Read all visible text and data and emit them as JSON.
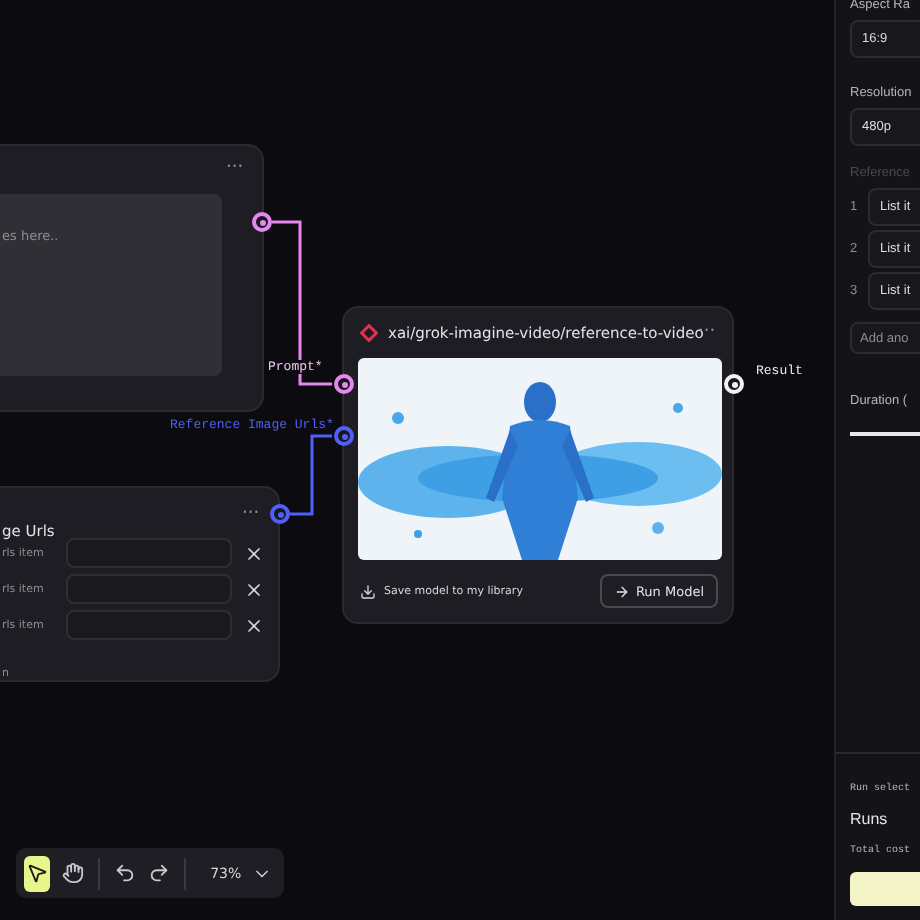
{
  "prompt_node": {
    "menu": "···",
    "placeholder": "es here.."
  },
  "reference_node": {
    "title": "ge Urls",
    "menu": "···",
    "items": [
      {
        "label": "rls item"
      },
      {
        "label": "rls item"
      },
      {
        "label": "rls item"
      }
    ],
    "add": "n"
  },
  "model_node": {
    "title": "xai/grok-imagine-video/reference-to-video",
    "menu": "···",
    "inputs": [
      {
        "label": "Prompt*",
        "color": "#e488ee"
      },
      {
        "label": "Reference Image Urls*",
        "color": "#4f5ff7"
      }
    ],
    "output": "Result",
    "save": "Save model to my library",
    "run": "Run Model"
  },
  "panel": {
    "aspect_label": "Aspect Ra",
    "aspect_value": "16:9",
    "resolution_label": "Resolution",
    "resolution_value": "480p",
    "reference_label": "Reference",
    "list": [
      {
        "index": "1",
        "value": "List it"
      },
      {
        "index": "2",
        "value": "List it"
      },
      {
        "index": "3",
        "value": "List it"
      }
    ],
    "add": "Add ano",
    "duration_label": "Duration (",
    "run_selected": "Run select",
    "runs": "Runs",
    "total_cost": "Total cost"
  },
  "toolbar": {
    "tools": [
      {
        "kind": "select",
        "selected": true
      },
      {
        "kind": "hand",
        "selected": false
      }
    ],
    "zoom": "73%"
  }
}
